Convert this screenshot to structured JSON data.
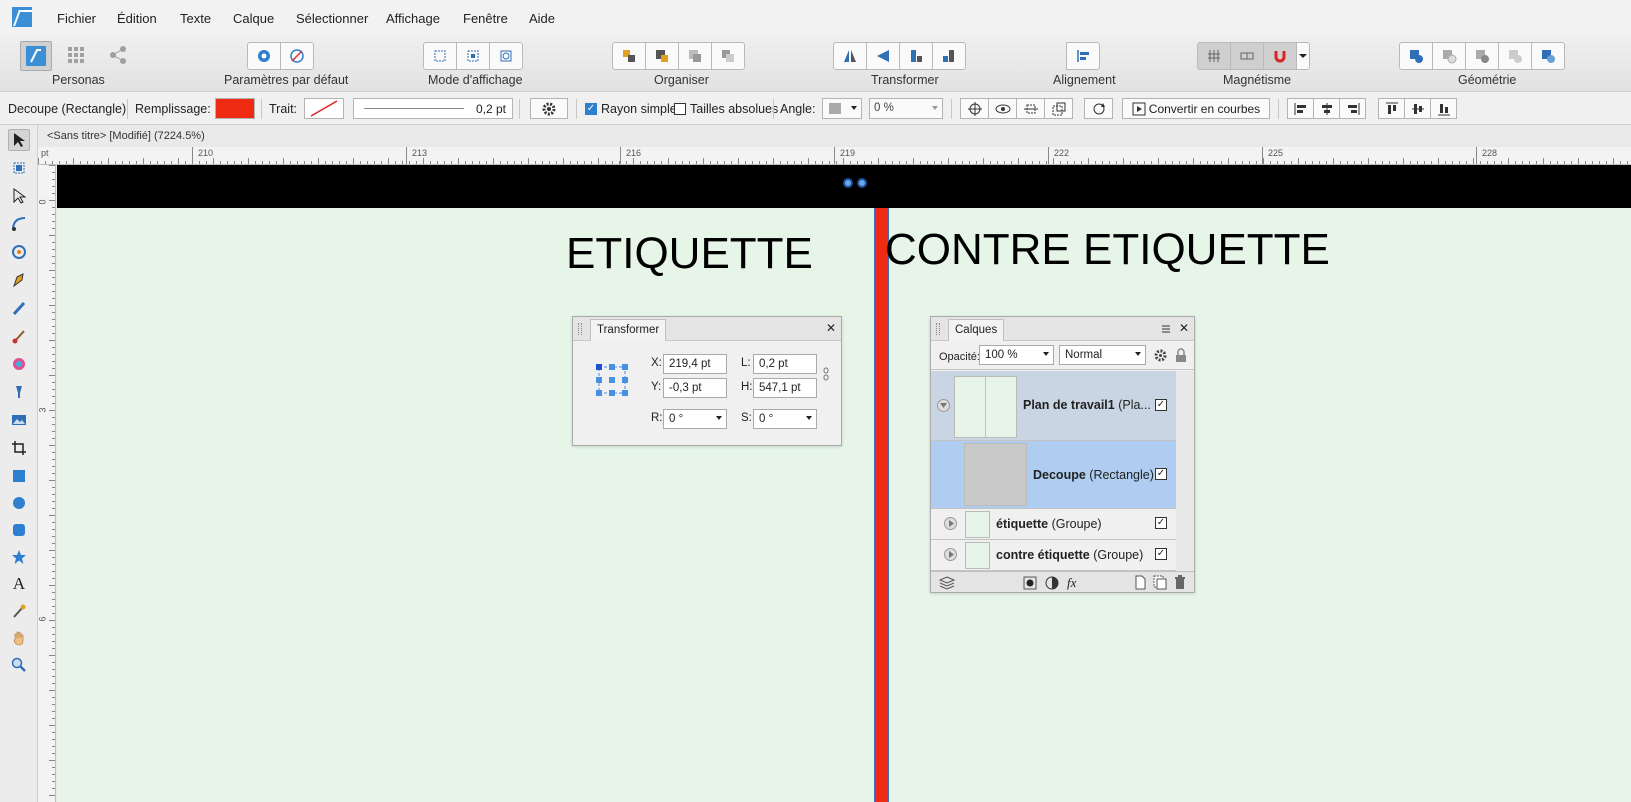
{
  "menu": [
    "Fichier",
    "Édition",
    "Texte",
    "Calque",
    "Sélectionner",
    "Affichage",
    "Fenêtre",
    "Aide"
  ],
  "toolbar": {
    "personas": "Personas",
    "defaults": "Paramètres par défaut",
    "view_mode": "Mode d'affichage",
    "arrange": "Organiser",
    "transform": "Transformer",
    "align": "Alignement",
    "snapping": "Magnétisme",
    "geometry": "Géométrie"
  },
  "context": {
    "selection": "Decoupe (Rectangle)",
    "fill_label": "Remplissage:",
    "fill_color": "#ee2a12",
    "stroke_label": "Trait:",
    "stroke_width": "0,2 pt",
    "simple_radius": "Rayon simple",
    "absolute_sizes": "Tailles absolues",
    "angle_label": "Angle:",
    "angle_value": "0 %",
    "convert": "Convertir en courbes"
  },
  "document": {
    "tab": "<Sans titre> [Modifié] (7224.5%)"
  },
  "ruler": {
    "unit": "pt",
    "top": [
      "210",
      "213",
      "216",
      "219",
      "222",
      "225",
      "228"
    ],
    "left": [
      "0",
      "3",
      "6"
    ]
  },
  "canvas": {
    "left_title": "ETIQUETTE",
    "right_title": "CONTRE ETIQUETTE",
    "band_color": "#000000",
    "background": "#e6f5e8"
  },
  "transform_panel": {
    "title": "Transformer",
    "x_label": "X:",
    "x": "219,4 pt",
    "y_label": "Y:",
    "y": "-0,3 pt",
    "w_label": "L:",
    "w": "0,2 pt",
    "h_label": "H:",
    "h": "547,1 pt",
    "r_label": "R:",
    "r": "0 °",
    "s_label": "S:",
    "s": "0 °"
  },
  "layers_panel": {
    "title": "Calques",
    "opacity_label": "Opacité:",
    "opacity": "100 %",
    "blend": "Normal",
    "layers": [
      {
        "name": "Plan de travail1",
        "type": "(Pla...",
        "checked": true
      },
      {
        "name": "Decoupe",
        "type": "(Rectangle)",
        "checked": true
      },
      {
        "name": "étiquette",
        "type": "(Groupe)",
        "checked": true
      },
      {
        "name": "contre étiquette",
        "type": "(Groupe)",
        "checked": true
      }
    ]
  }
}
